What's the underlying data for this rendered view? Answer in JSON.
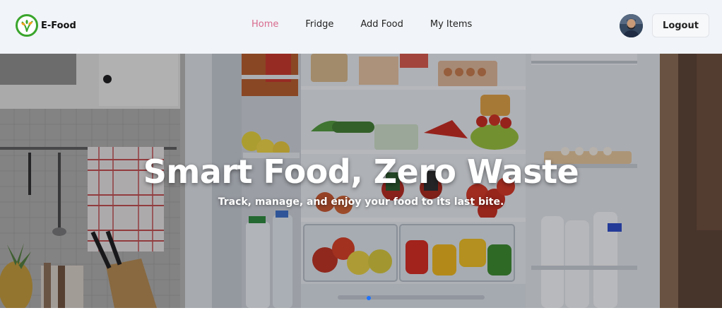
{
  "brand": {
    "name": "E-Food",
    "logo_icon": "leaf-logo-icon",
    "accent": "#3aa52c"
  },
  "nav": {
    "links": [
      {
        "label": "Home",
        "active": true
      },
      {
        "label": "Fridge",
        "active": false
      },
      {
        "label": "Add Food",
        "active": false
      },
      {
        "label": "My Items",
        "active": false
      }
    ],
    "active_color": "#d86a8e"
  },
  "user": {
    "avatar_icon": "user-avatar-icon",
    "logout_label": "Logout"
  },
  "hero": {
    "title": "Smart Food, Zero Waste",
    "subtitle": "Track, manage, and enjoy your food to its last bite.",
    "image_icon": "open-fridge-photo",
    "carousel": {
      "slides": 1,
      "active_slide": 1,
      "dot_color": "#1e74ff"
    }
  }
}
